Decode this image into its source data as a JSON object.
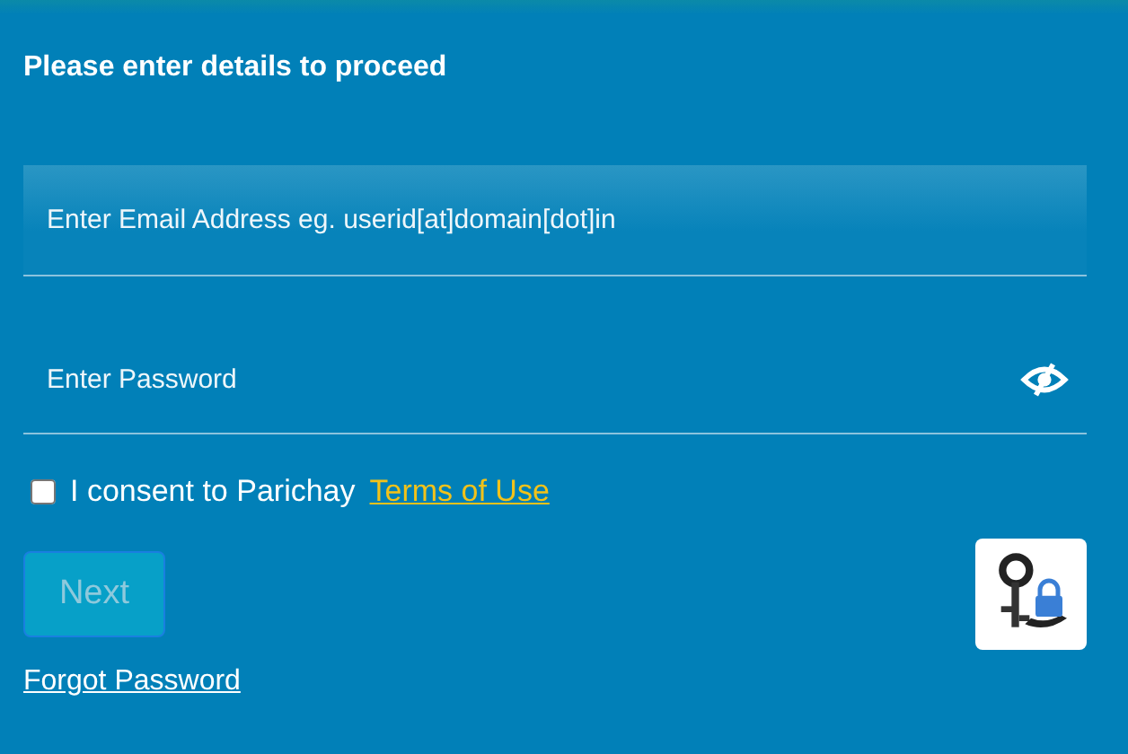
{
  "heading": "Please enter details to proceed",
  "email_field": {
    "placeholder": "Enter Email Address eg. userid[at]domain[dot]in"
  },
  "password_field": {
    "placeholder": "Enter Password"
  },
  "consent": {
    "checked": false,
    "text": "I consent to Parichay",
    "link": "Terms of Use"
  },
  "next_button": {
    "label": "Next",
    "disabled": true
  },
  "forgot_link": "Forgot Password"
}
